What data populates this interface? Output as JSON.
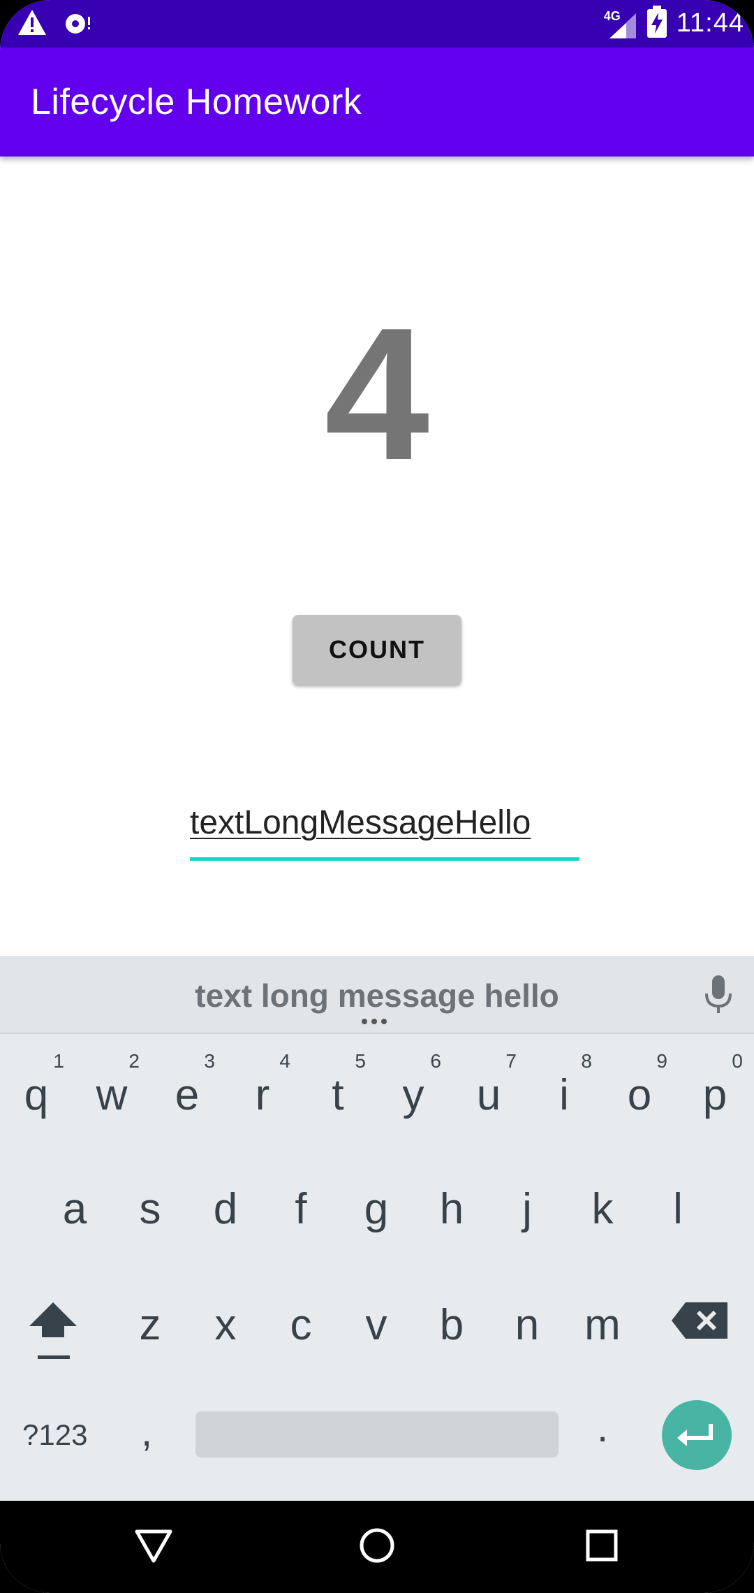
{
  "status_bar": {
    "time": "11:44",
    "network_label": "4G",
    "icons": [
      "warning-icon",
      "sync-disc-icon",
      "signal-icon",
      "battery-charging-icon"
    ]
  },
  "app_bar": {
    "title": "Lifecycle Homework"
  },
  "main": {
    "counter_value": "4",
    "count_button_label": "COUNT",
    "text_field_value": "textLongMessageHello"
  },
  "keyboard": {
    "suggestion": "text long message hello",
    "row1": [
      {
        "letter": "q",
        "hint": "1"
      },
      {
        "letter": "w",
        "hint": "2"
      },
      {
        "letter": "e",
        "hint": "3"
      },
      {
        "letter": "r",
        "hint": "4"
      },
      {
        "letter": "t",
        "hint": "5"
      },
      {
        "letter": "y",
        "hint": "6"
      },
      {
        "letter": "u",
        "hint": "7"
      },
      {
        "letter": "i",
        "hint": "8"
      },
      {
        "letter": "o",
        "hint": "9"
      },
      {
        "letter": "p",
        "hint": "0"
      }
    ],
    "row2": [
      "a",
      "s",
      "d",
      "f",
      "g",
      "h",
      "j",
      "k",
      "l"
    ],
    "row3": [
      "z",
      "x",
      "c",
      "v",
      "b",
      "n",
      "m"
    ],
    "symbols_label": "?123",
    "comma_label": ",",
    "period_label": ".",
    "icons": [
      "mic-icon",
      "shift-icon",
      "backspace-icon",
      "enter-icon"
    ]
  },
  "nav_bar": {
    "icons": [
      "back-icon",
      "home-icon",
      "recents-icon"
    ]
  },
  "colors": {
    "status_bar": "#3700b3",
    "app_bar": "#6200ee",
    "accent": "#1dd2c6",
    "enter_key": "#47b4a4"
  }
}
